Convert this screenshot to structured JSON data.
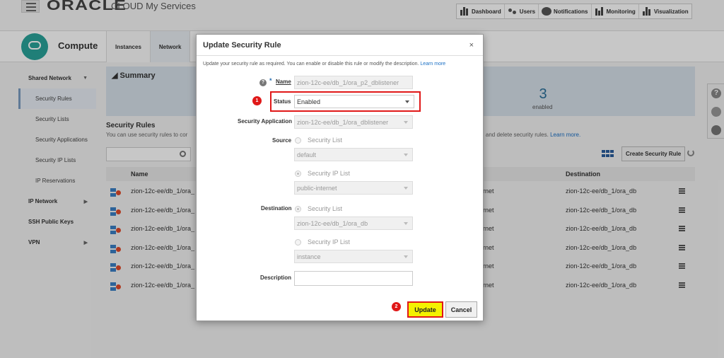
{
  "topbar": {
    "logo": "ORACLE",
    "subtitle": "CLOUD My Services",
    "nav": [
      "Dashboard",
      "Users",
      "Notifications",
      "Monitoring",
      "Visualization"
    ]
  },
  "service": {
    "title": "Compute",
    "tabs": [
      "Instances",
      "Network"
    ]
  },
  "sidebar": [
    {
      "label": "Shared Network",
      "type": "hdr"
    },
    {
      "label": "Security Rules",
      "type": "sub"
    },
    {
      "label": "Security Lists",
      "type": "sub"
    },
    {
      "label": "Security Applications",
      "type": "sub"
    },
    {
      "label": "Security IP Lists",
      "type": "sub"
    },
    {
      "label": "IP Reservations",
      "type": "sub"
    },
    {
      "label": "IP Network",
      "type": "hdr"
    },
    {
      "label": "SSH Public Keys",
      "type": "hdr"
    },
    {
      "label": "VPN",
      "type": "hdr"
    }
  ],
  "summary": {
    "title": "Summary",
    "count": "3",
    "count_label": "enabled"
  },
  "rules_section": {
    "title": "Security Rules",
    "desc_left": "You can use security rules to cor",
    "desc_right": "e, and delete security rules.",
    "learn_more": "Learn more.",
    "create_button": "Create Security Rule",
    "columns": {
      "name": "Name",
      "destination": "Destination"
    },
    "rows": [
      {
        "name": "zion-12c-ee/db_1/ora_",
        "mid": "ernet",
        "dest": "zion-12c-ee/db_1/ora_db"
      },
      {
        "name": "zion-12c-ee/db_1/ora_",
        "mid": "ernet",
        "dest": "zion-12c-ee/db_1/ora_db"
      },
      {
        "name": "zion-12c-ee/db_1/ora_",
        "mid": "ernet",
        "dest": "zion-12c-ee/db_1/ora_db"
      },
      {
        "name": "zion-12c-ee/db_1/ora_",
        "mid": "ernet",
        "dest": "zion-12c-ee/db_1/ora_db"
      },
      {
        "name": "zion-12c-ee/db_1/ora_",
        "mid": "ernet",
        "dest": "zion-12c-ee/db_1/ora_db"
      },
      {
        "name": "zion-12c-ee/db_1/ora_",
        "mid": "ernet",
        "dest": "zion-12c-ee/db_1/ora_db"
      }
    ]
  },
  "modal": {
    "title": "Update Security Rule",
    "close": "×",
    "description": "Update your security rule as required. You can enable or disable this rule or modify the description.",
    "learn_more": "Learn more",
    "name_label": "Name",
    "name_required": "*",
    "name_value": "zion-12c-ee/db_1/ora_p2_dblistener",
    "status_label": "Status",
    "status_value": "Enabled",
    "secapp_label": "Security Application",
    "secapp_value": "zion-12c-ee/db_1/ora_dblistener",
    "source_label": "Source",
    "source_opt1": "Security List",
    "source_list_value": "default",
    "source_opt2": "Security IP List",
    "source_ip_value": "public-internet",
    "dest_label": "Destination",
    "dest_opt1": "Security List",
    "dest_list_value": "zion-12c-ee/db_1/ora_db",
    "dest_opt2": "Security IP List",
    "dest_ip_value": "instance",
    "desc_label": "Description",
    "desc_value": "",
    "update_button": "Update",
    "cancel_button": "Cancel",
    "step1": "1",
    "step2": "2",
    "help": "?"
  },
  "float_tools": [
    "?"
  ]
}
